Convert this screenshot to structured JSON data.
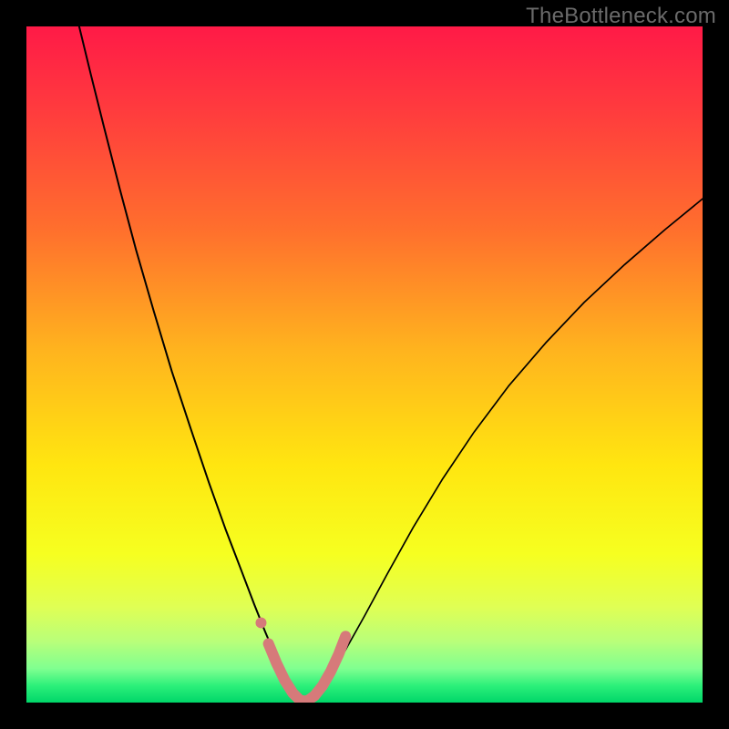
{
  "watermark": "TheBottleneck.com",
  "chart_data": {
    "type": "line",
    "title": "",
    "xlabel": "",
    "ylabel": "",
    "xlim": [
      0,
      100
    ],
    "ylim": [
      0,
      100
    ],
    "background_gradient": {
      "stops": [
        {
          "offset": 0.0,
          "color": "#ff1a47"
        },
        {
          "offset": 0.12,
          "color": "#ff3a3e"
        },
        {
          "offset": 0.3,
          "color": "#ff6f2d"
        },
        {
          "offset": 0.48,
          "color": "#ffb41e"
        },
        {
          "offset": 0.65,
          "color": "#ffe610"
        },
        {
          "offset": 0.78,
          "color": "#f6ff20"
        },
        {
          "offset": 0.86,
          "color": "#dfff55"
        },
        {
          "offset": 0.91,
          "color": "#b8ff7a"
        },
        {
          "offset": 0.95,
          "color": "#7fff90"
        },
        {
          "offset": 0.975,
          "color": "#2cf07a"
        },
        {
          "offset": 1.0,
          "color": "#00d669"
        }
      ]
    },
    "series": [
      {
        "name": "curve-left",
        "stroke": "#000000",
        "width": 2.0,
        "points": [
          {
            "x": 7.8,
            "y": 100.0
          },
          {
            "x": 9.5,
            "y": 93.0
          },
          {
            "x": 11.5,
            "y": 85.0
          },
          {
            "x": 13.8,
            "y": 76.0
          },
          {
            "x": 16.2,
            "y": 67.0
          },
          {
            "x": 18.8,
            "y": 58.0
          },
          {
            "x": 21.5,
            "y": 49.0
          },
          {
            "x": 24.3,
            "y": 40.5
          },
          {
            "x": 27.0,
            "y": 32.5
          },
          {
            "x": 29.5,
            "y": 25.5
          },
          {
            "x": 31.8,
            "y": 19.5
          },
          {
            "x": 33.7,
            "y": 14.5
          },
          {
            "x": 35.3,
            "y": 10.5
          },
          {
            "x": 36.7,
            "y": 7.2
          },
          {
            "x": 37.8,
            "y": 4.7
          },
          {
            "x": 38.8,
            "y": 2.8
          },
          {
            "x": 39.7,
            "y": 1.3
          },
          {
            "x": 40.5,
            "y": 0.4
          },
          {
            "x": 41.0,
            "y": 0.0
          }
        ]
      },
      {
        "name": "curve-right",
        "stroke": "#000000",
        "width": 1.7,
        "points": [
          {
            "x": 41.0,
            "y": 0.0
          },
          {
            "x": 42.0,
            "y": 0.5
          },
          {
            "x": 43.3,
            "y": 1.8
          },
          {
            "x": 45.0,
            "y": 4.2
          },
          {
            "x": 47.2,
            "y": 7.8
          },
          {
            "x": 50.0,
            "y": 12.8
          },
          {
            "x": 53.3,
            "y": 18.9
          },
          {
            "x": 57.2,
            "y": 25.9
          },
          {
            "x": 61.5,
            "y": 33.0
          },
          {
            "x": 66.2,
            "y": 40.0
          },
          {
            "x": 71.3,
            "y": 46.8
          },
          {
            "x": 76.8,
            "y": 53.2
          },
          {
            "x": 82.5,
            "y": 59.2
          },
          {
            "x": 88.5,
            "y": 64.8
          },
          {
            "x": 94.5,
            "y": 70.0
          },
          {
            "x": 100.0,
            "y": 74.5
          }
        ]
      }
    ],
    "highlight_band": {
      "name": "bottom-highlight",
      "color": "#d67a7a",
      "width": 12,
      "dot_at": {
        "x": 34.7,
        "y": 11.8,
        "r": 6
      },
      "points": [
        {
          "x": 35.8,
          "y": 8.7
        },
        {
          "x": 37.0,
          "y": 5.8
        },
        {
          "x": 38.2,
          "y": 3.3
        },
        {
          "x": 39.4,
          "y": 1.4
        },
        {
          "x": 40.5,
          "y": 0.3
        },
        {
          "x": 41.5,
          "y": 0.2
        },
        {
          "x": 42.6,
          "y": 1.0
        },
        {
          "x": 43.8,
          "y": 2.5
        },
        {
          "x": 45.0,
          "y": 4.6
        },
        {
          "x": 46.2,
          "y": 7.2
        },
        {
          "x": 47.2,
          "y": 9.8
        }
      ]
    }
  }
}
